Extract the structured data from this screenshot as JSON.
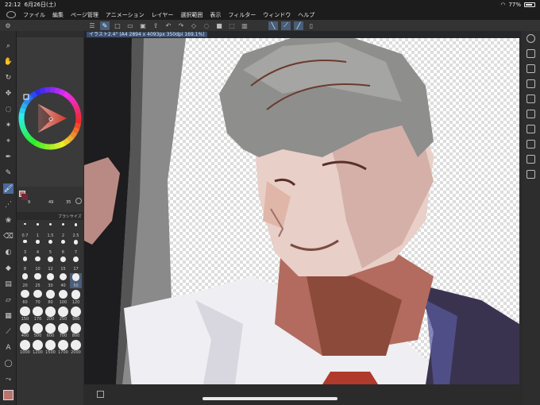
{
  "status": {
    "time": "22:12",
    "date": "6月26日(土)",
    "battery": "77%",
    "battery_level": 0.77
  },
  "menu": [
    "ファイル",
    "編集",
    "ページ管理",
    "アニメーション",
    "レイヤー",
    "選択範囲",
    "表示",
    "フィルター",
    "ウィンドウ",
    "ヘルプ"
  ],
  "document": {
    "tab_label": "イラスト2.4° (A4 2894 x 4093px 350dpi 169.1%)"
  },
  "color": {
    "main": "#b8746e",
    "sub": "#6b2a3a",
    "hue_accent": "#d04030"
  },
  "brush_panel": {
    "header": "ブラシサイズ",
    "sizes": [
      "0.7",
      "1",
      "1.5",
      "2",
      "2.5",
      "3",
      "4",
      "5",
      "6",
      "7",
      "8",
      "10",
      "12",
      "15",
      "17",
      "20",
      "25",
      "30",
      "40",
      "50",
      "60",
      "70",
      "80",
      "100",
      "120",
      "150",
      "170",
      "200",
      "250",
      "300",
      "400",
      "500",
      "600",
      "700",
      "800",
      "1000",
      "1200",
      "1500",
      "1700",
      "2000"
    ],
    "selected": "50",
    "small_values": [
      "9",
      "49",
      "35"
    ]
  },
  "icons": {
    "left_tools": [
      "zoom-icon",
      "hand-icon",
      "rotate-icon",
      "move-icon",
      "lasso-icon",
      "magic-wand-icon",
      "eyedropper-icon",
      "pen-icon",
      "pencil-icon",
      "brush-icon",
      "airbrush-icon",
      "decoration-icon",
      "eraser-icon",
      "blend-icon",
      "fill-icon",
      "gradient-icon",
      "figure-icon",
      "frame-icon",
      "ruler-icon",
      "text-icon",
      "balloon-icon",
      "correct-line-icon",
      "color-swatch-icon"
    ],
    "right_tools": [
      "color-wheel-panel-icon",
      "layer-panel-icon",
      "navigator-icon",
      "tool-property-icon",
      "subtool-icon",
      "material-icon",
      "history-icon",
      "auto-action-icon",
      "sub-view-icon",
      "quick-access-icon"
    ]
  }
}
